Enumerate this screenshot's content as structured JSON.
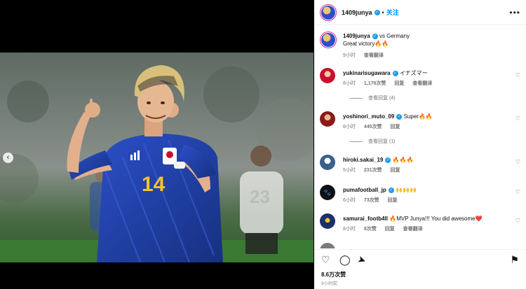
{
  "post": {
    "author": "1409junya",
    "follow_label": "关注",
    "separator": "•",
    "more_icon": "•••",
    "caption_line1": "vs Germany",
    "caption_line2": "Great victory🔥🔥",
    "caption_time": "9小时",
    "caption_translate": "查看翻译",
    "likes": "8.6万次赞",
    "posted_ago": "9小时前"
  },
  "photo": {
    "jersey_number": "14",
    "background_number": "23"
  },
  "comments": [
    {
      "user": "yukinarisugawara",
      "verified": true,
      "text": "イナズマー",
      "time": "8小时",
      "likes": "1,176次赞",
      "reply": "回复",
      "translate": "查看翻译",
      "replies": "查看回复 (4)",
      "avatar_color": "#c8102e"
    },
    {
      "user": "yoshinori_muto_09",
      "verified": true,
      "text": "Super🔥🔥",
      "time": "8小时",
      "likes": "445次赞",
      "reply": "回复",
      "translate": "",
      "replies": "查看回复 (1)",
      "avatar_color": "#8b1a1a"
    },
    {
      "user": "hiroki.sakai_19",
      "verified": true,
      "text": "🔥🔥🔥",
      "time": "5小时",
      "likes": "231次赞",
      "reply": "回复",
      "translate": "",
      "replies": "",
      "avatar_color": "#3a5f8a"
    },
    {
      "user": "pumafootball_jp",
      "verified": true,
      "text": "🙌🙌🙌",
      "time": "6小时",
      "likes": "73次赞",
      "reply": "回复",
      "translate": "",
      "replies": "",
      "avatar_color": "#111111"
    },
    {
      "user": "samurai_footb4ll",
      "verified": false,
      "text": "🔥MVP Junya!!! You did awesome❤️",
      "time": "8小时",
      "likes": "8次赞",
      "reply": "回复",
      "translate": "查看翻译",
      "replies": "",
      "avatar_color": "#1c2f6e"
    }
  ],
  "colors": {
    "follow": "#0095f6",
    "verified": "#1d9bf0",
    "jersey": "#1f3fb0",
    "number": "#f2c230"
  }
}
